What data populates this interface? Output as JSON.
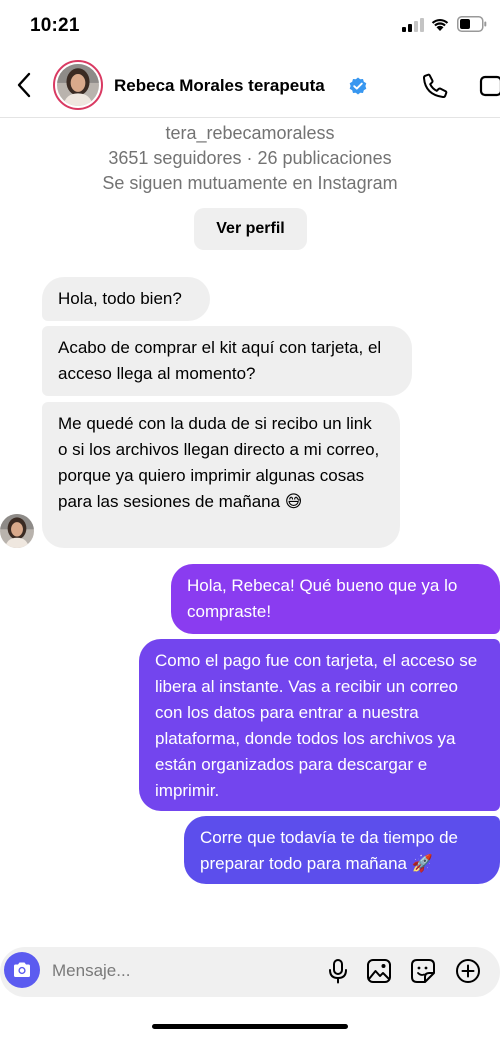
{
  "status_bar": {
    "time": "10:21",
    "icons": [
      "signal-icon",
      "wifi-icon",
      "battery-icon"
    ]
  },
  "header": {
    "name": "Rebeca Morales terapeuta",
    "verified": true,
    "icons": [
      "back-icon",
      "phone-icon",
      "video-icon",
      "verified-icon"
    ]
  },
  "profile": {
    "username": "tera_rebecamoraless",
    "stats": "3651 seguidores · 26 publicaciones",
    "mutual": "Se siguen mutuamente en Instagram",
    "view_profile_label": "Ver perfil"
  },
  "messages": [
    {
      "from": "them",
      "text": "Hola, todo bien?"
    },
    {
      "from": "them",
      "text": "Acabo de comprar el kit aquí con tarjeta, el acceso llega al momento?"
    },
    {
      "from": "them",
      "text": "Me quedé con la duda de si recibo un link o si los archivos llegan directo a mi correo, porque ya quiero imprimir algunas cosas para las sesiones de mañana 😅"
    },
    {
      "from": "me",
      "text": "Hola, Rebeca! Qué bueno que ya lo compraste!"
    },
    {
      "from": "me",
      "text": "Como el pago fue con tarjeta, el acceso se libera al instante. Vas a recibir un correo con los datos para entrar a nuestra plataforma, donde todos los archivos ya están organizados para descargar e imprimir."
    },
    {
      "from": "me",
      "text": "Corre que todavía te da tiempo de preparar todo para mañana 🚀"
    }
  ],
  "composer": {
    "placeholder": "Mensaje...",
    "icons": [
      "camera-icon",
      "microphone-icon",
      "gallery-icon",
      "sticker-icon",
      "plus-icon"
    ]
  },
  "colors": {
    "incoming_bubble": "#efefef",
    "outgoing_top": "#8a3cf0",
    "outgoing_bottom": "#5a4fec",
    "avatar_ring": "#d93a62",
    "verified": "#3897f0",
    "camera_button": "#5b5bf0"
  }
}
